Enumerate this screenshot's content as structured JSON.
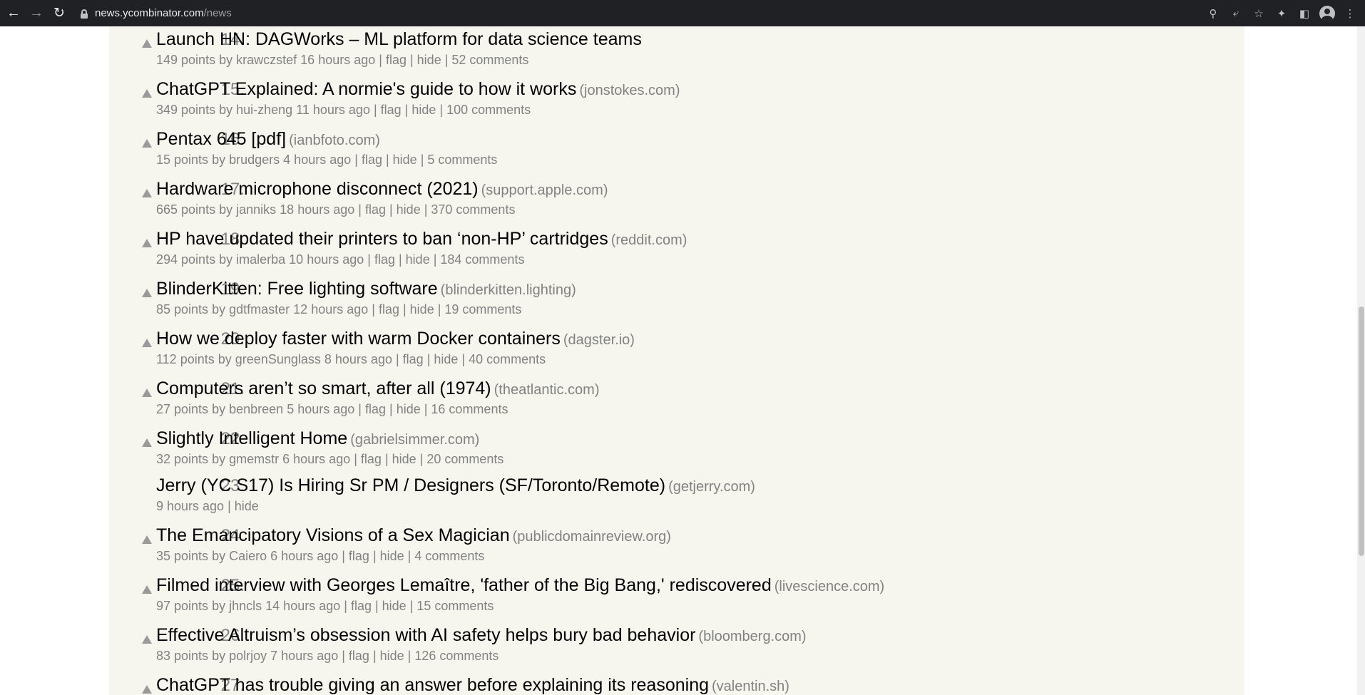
{
  "browser": {
    "url_domain": "news.ycombinator.com",
    "url_path": "/news"
  },
  "stories": [
    {
      "rank": "14.",
      "title": "Launch HN: DAGWorks – ML platform for data science teams",
      "site": "",
      "points": "149 points",
      "by": "by",
      "user": "krawczstef",
      "age": "16 hours ago",
      "flag": "flag",
      "hide": "hide",
      "comments": "52 comments",
      "has_vote": true
    },
    {
      "rank": "15.",
      "title": "ChatGPT Explained: A normie's guide to how it works",
      "site": "(jonstokes.com)",
      "points": "349 points",
      "by": "by",
      "user": "hui-zheng",
      "age": "11 hours ago",
      "flag": "flag",
      "hide": "hide",
      "comments": "100 comments",
      "has_vote": true
    },
    {
      "rank": "16.",
      "title": "Pentax 645 [pdf]",
      "site": "(ianbfoto.com)",
      "points": "15 points",
      "by": "by",
      "user": "brudgers",
      "age": "4 hours ago",
      "flag": "flag",
      "hide": "hide",
      "comments": "5 comments",
      "has_vote": true
    },
    {
      "rank": "17.",
      "title": "Hardware microphone disconnect (2021)",
      "site": "(support.apple.com)",
      "points": "665 points",
      "by": "by",
      "user": "janniks",
      "age": "18 hours ago",
      "flag": "flag",
      "hide": "hide",
      "comments": "370 comments",
      "has_vote": true
    },
    {
      "rank": "18.",
      "title": "HP have updated their printers to ban ‘non-HP’ cartridges",
      "site": "(reddit.com)",
      "points": "294 points",
      "by": "by",
      "user": "imalerba",
      "age": "10 hours ago",
      "flag": "flag",
      "hide": "hide",
      "comments": "184 comments",
      "has_vote": true
    },
    {
      "rank": "19.",
      "title": "BlinderKitten: Free lighting software",
      "site": "(blinderkitten.lighting)",
      "points": "85 points",
      "by": "by",
      "user": "gdtfmaster",
      "age": "12 hours ago",
      "flag": "flag",
      "hide": "hide",
      "comments": "19 comments",
      "has_vote": true
    },
    {
      "rank": "20.",
      "title": "How we deploy faster with warm Docker containers",
      "site": "(dagster.io)",
      "points": "112 points",
      "by": "by",
      "user": "greenSunglass",
      "age": "8 hours ago",
      "flag": "flag",
      "hide": "hide",
      "comments": "40 comments",
      "has_vote": true
    },
    {
      "rank": "21.",
      "title": "Computers aren’t so smart, after all (1974)",
      "site": "(theatlantic.com)",
      "points": "27 points",
      "by": "by",
      "user": "benbreen",
      "age": "5 hours ago",
      "flag": "flag",
      "hide": "hide",
      "comments": "16 comments",
      "has_vote": true
    },
    {
      "rank": "22.",
      "title": "Slightly Intelligent Home",
      "site": "(gabrielsimmer.com)",
      "points": "32 points",
      "by": "by",
      "user": "gmemstr",
      "age": "6 hours ago",
      "flag": "flag",
      "hide": "hide",
      "comments": "20 comments",
      "has_vote": true
    },
    {
      "rank": "23.",
      "title": "Jerry (YC S17) Is Hiring Sr PM / Designers (SF/Toronto/Remote)",
      "site": "(getjerry.com)",
      "age": "9 hours ago",
      "hide": "hide",
      "is_job": true,
      "has_vote": false
    },
    {
      "rank": "24.",
      "title": "The Emancipatory Visions of a Sex Magician",
      "site": "(publicdomainreview.org)",
      "points": "35 points",
      "by": "by",
      "user": "Caiero",
      "age": "6 hours ago",
      "flag": "flag",
      "hide": "hide",
      "comments": "4 comments",
      "has_vote": true
    },
    {
      "rank": "25.",
      "title": "Filmed interview with Georges Lemaître, 'father of the Big Bang,' rediscovered",
      "site": "(livescience.com)",
      "points": "97 points",
      "by": "by",
      "user": "jhncls",
      "age": "14 hours ago",
      "flag": "flag",
      "hide": "hide",
      "comments": "15 comments",
      "has_vote": true
    },
    {
      "rank": "26.",
      "title": "Effective Altruism’s obsession with AI safety helps bury bad behavior",
      "site": "(bloomberg.com)",
      "points": "83 points",
      "by": "by",
      "user": "polrjoy",
      "age": "7 hours ago",
      "flag": "flag",
      "hide": "hide",
      "comments": "126 comments",
      "has_vote": true
    },
    {
      "rank": "27.",
      "title": "ChatGPT has trouble giving an answer before explaining its reasoning",
      "site": "(valentin.sh)",
      "points": "",
      "by": "",
      "user": "",
      "age": "",
      "flag": "",
      "hide": "",
      "comments": "",
      "has_vote": true
    }
  ]
}
